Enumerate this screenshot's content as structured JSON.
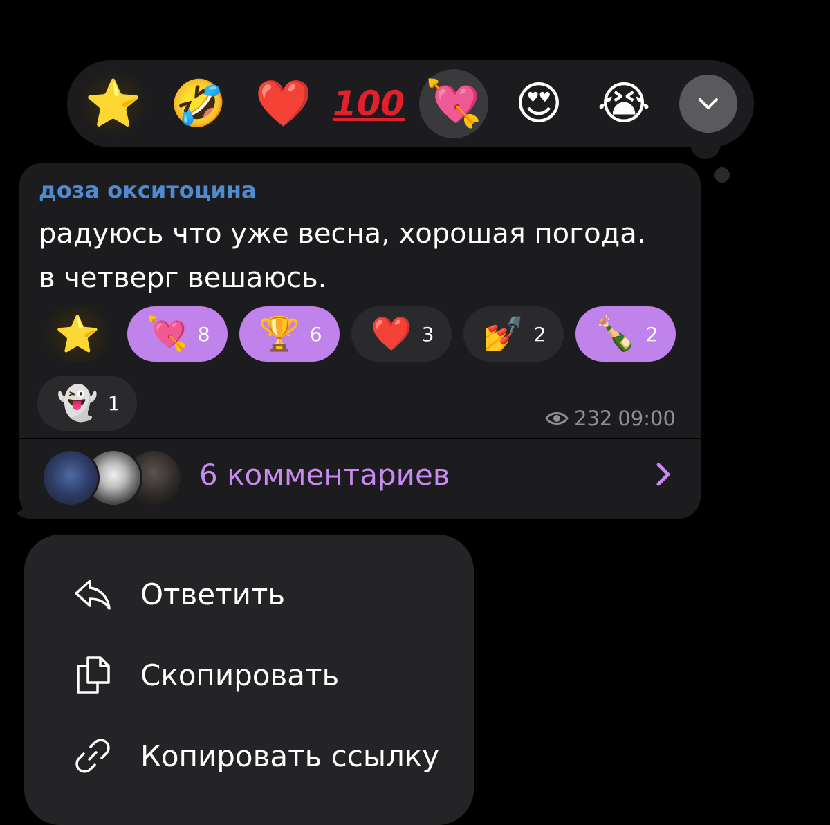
{
  "picker": {
    "reactions": [
      {
        "name": "star",
        "glyph": "⭐"
      },
      {
        "name": "rofl",
        "glyph": "🤣"
      },
      {
        "name": "heart",
        "glyph": "❤️"
      },
      {
        "name": "hundred",
        "glyph": "100"
      },
      {
        "name": "heart-arrow",
        "glyph": "💘"
      },
      {
        "name": "heart-eyes",
        "glyph": "😍"
      },
      {
        "name": "loudly-crying",
        "glyph": "😭"
      }
    ],
    "more_icon": "chevron-down-icon",
    "more_glyph": "⌄"
  },
  "message": {
    "sender": "доза окситоцина",
    "text_line1": "радуюсь что уже весна, хорошая погода.",
    "text_line2": "в четверг вешаюсь.",
    "reactions": [
      {
        "glyph": "⭐",
        "count": ""
      },
      {
        "glyph": "💘",
        "count": "8"
      },
      {
        "glyph": "🏆",
        "count": "6"
      },
      {
        "glyph": "❤️",
        "count": "3"
      },
      {
        "glyph": "💅",
        "count": "2"
      },
      {
        "glyph": "🍾",
        "count": "2"
      },
      {
        "glyph": "👻",
        "count": "1"
      }
    ],
    "views": "232",
    "time": "09:00",
    "comments_label": "6 комментариев"
  },
  "menu": {
    "items": [
      {
        "label": "Ответить",
        "icon": "reply-icon"
      },
      {
        "label": "Скопировать",
        "icon": "copy-icon"
      },
      {
        "label": "Копировать ссылку",
        "icon": "link-icon"
      }
    ]
  },
  "colors": {
    "background": "#000000",
    "bubble": "#1c1c1e",
    "accent_purple": "#c082eb",
    "sender_blue": "#4f8bd1",
    "meta_gray": "#8e8e93"
  }
}
